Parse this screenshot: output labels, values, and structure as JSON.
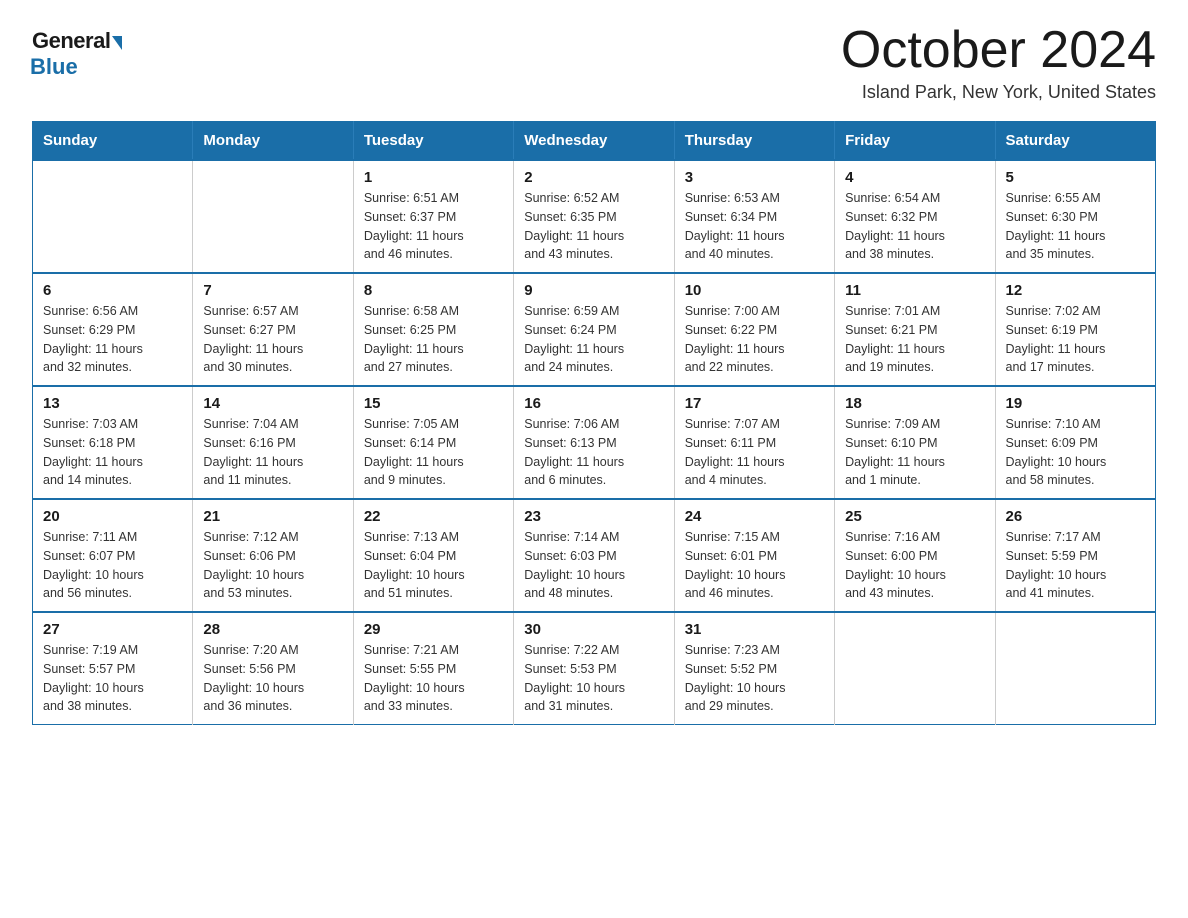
{
  "logo": {
    "general": "General",
    "blue": "Blue"
  },
  "header": {
    "month": "October 2024",
    "location": "Island Park, New York, United States"
  },
  "weekdays": [
    "Sunday",
    "Monday",
    "Tuesday",
    "Wednesday",
    "Thursday",
    "Friday",
    "Saturday"
  ],
  "weeks": [
    [
      {
        "day": "",
        "info": ""
      },
      {
        "day": "",
        "info": ""
      },
      {
        "day": "1",
        "info": "Sunrise: 6:51 AM\nSunset: 6:37 PM\nDaylight: 11 hours\nand 46 minutes."
      },
      {
        "day": "2",
        "info": "Sunrise: 6:52 AM\nSunset: 6:35 PM\nDaylight: 11 hours\nand 43 minutes."
      },
      {
        "day": "3",
        "info": "Sunrise: 6:53 AM\nSunset: 6:34 PM\nDaylight: 11 hours\nand 40 minutes."
      },
      {
        "day": "4",
        "info": "Sunrise: 6:54 AM\nSunset: 6:32 PM\nDaylight: 11 hours\nand 38 minutes."
      },
      {
        "day": "5",
        "info": "Sunrise: 6:55 AM\nSunset: 6:30 PM\nDaylight: 11 hours\nand 35 minutes."
      }
    ],
    [
      {
        "day": "6",
        "info": "Sunrise: 6:56 AM\nSunset: 6:29 PM\nDaylight: 11 hours\nand 32 minutes."
      },
      {
        "day": "7",
        "info": "Sunrise: 6:57 AM\nSunset: 6:27 PM\nDaylight: 11 hours\nand 30 minutes."
      },
      {
        "day": "8",
        "info": "Sunrise: 6:58 AM\nSunset: 6:25 PM\nDaylight: 11 hours\nand 27 minutes."
      },
      {
        "day": "9",
        "info": "Sunrise: 6:59 AM\nSunset: 6:24 PM\nDaylight: 11 hours\nand 24 minutes."
      },
      {
        "day": "10",
        "info": "Sunrise: 7:00 AM\nSunset: 6:22 PM\nDaylight: 11 hours\nand 22 minutes."
      },
      {
        "day": "11",
        "info": "Sunrise: 7:01 AM\nSunset: 6:21 PM\nDaylight: 11 hours\nand 19 minutes."
      },
      {
        "day": "12",
        "info": "Sunrise: 7:02 AM\nSunset: 6:19 PM\nDaylight: 11 hours\nand 17 minutes."
      }
    ],
    [
      {
        "day": "13",
        "info": "Sunrise: 7:03 AM\nSunset: 6:18 PM\nDaylight: 11 hours\nand 14 minutes."
      },
      {
        "day": "14",
        "info": "Sunrise: 7:04 AM\nSunset: 6:16 PM\nDaylight: 11 hours\nand 11 minutes."
      },
      {
        "day": "15",
        "info": "Sunrise: 7:05 AM\nSunset: 6:14 PM\nDaylight: 11 hours\nand 9 minutes."
      },
      {
        "day": "16",
        "info": "Sunrise: 7:06 AM\nSunset: 6:13 PM\nDaylight: 11 hours\nand 6 minutes."
      },
      {
        "day": "17",
        "info": "Sunrise: 7:07 AM\nSunset: 6:11 PM\nDaylight: 11 hours\nand 4 minutes."
      },
      {
        "day": "18",
        "info": "Sunrise: 7:09 AM\nSunset: 6:10 PM\nDaylight: 11 hours\nand 1 minute."
      },
      {
        "day": "19",
        "info": "Sunrise: 7:10 AM\nSunset: 6:09 PM\nDaylight: 10 hours\nand 58 minutes."
      }
    ],
    [
      {
        "day": "20",
        "info": "Sunrise: 7:11 AM\nSunset: 6:07 PM\nDaylight: 10 hours\nand 56 minutes."
      },
      {
        "day": "21",
        "info": "Sunrise: 7:12 AM\nSunset: 6:06 PM\nDaylight: 10 hours\nand 53 minutes."
      },
      {
        "day": "22",
        "info": "Sunrise: 7:13 AM\nSunset: 6:04 PM\nDaylight: 10 hours\nand 51 minutes."
      },
      {
        "day": "23",
        "info": "Sunrise: 7:14 AM\nSunset: 6:03 PM\nDaylight: 10 hours\nand 48 minutes."
      },
      {
        "day": "24",
        "info": "Sunrise: 7:15 AM\nSunset: 6:01 PM\nDaylight: 10 hours\nand 46 minutes."
      },
      {
        "day": "25",
        "info": "Sunrise: 7:16 AM\nSunset: 6:00 PM\nDaylight: 10 hours\nand 43 minutes."
      },
      {
        "day": "26",
        "info": "Sunrise: 7:17 AM\nSunset: 5:59 PM\nDaylight: 10 hours\nand 41 minutes."
      }
    ],
    [
      {
        "day": "27",
        "info": "Sunrise: 7:19 AM\nSunset: 5:57 PM\nDaylight: 10 hours\nand 38 minutes."
      },
      {
        "day": "28",
        "info": "Sunrise: 7:20 AM\nSunset: 5:56 PM\nDaylight: 10 hours\nand 36 minutes."
      },
      {
        "day": "29",
        "info": "Sunrise: 7:21 AM\nSunset: 5:55 PM\nDaylight: 10 hours\nand 33 minutes."
      },
      {
        "day": "30",
        "info": "Sunrise: 7:22 AM\nSunset: 5:53 PM\nDaylight: 10 hours\nand 31 minutes."
      },
      {
        "day": "31",
        "info": "Sunrise: 7:23 AM\nSunset: 5:52 PM\nDaylight: 10 hours\nand 29 minutes."
      },
      {
        "day": "",
        "info": ""
      },
      {
        "day": "",
        "info": ""
      }
    ]
  ]
}
